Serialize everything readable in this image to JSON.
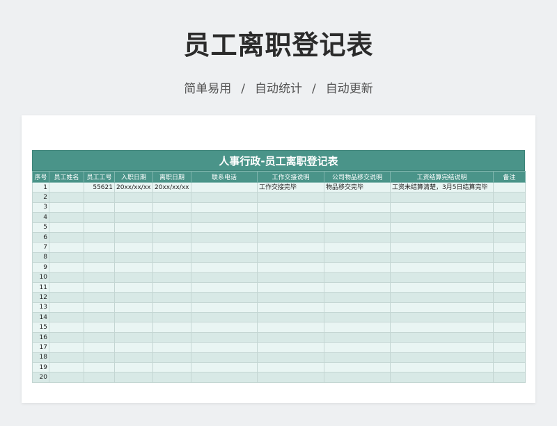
{
  "header": {
    "title": "员工离职登记表",
    "subtitle_parts": [
      "简单易用",
      "自动统计",
      "自动更新"
    ],
    "separator": "/"
  },
  "sheet": {
    "title": "人事行政-员工离职登记表",
    "columns": [
      "序号",
      "员工姓名",
      "员工工号",
      "入职日期",
      "离职日期",
      "联系电话",
      "工作交接说明",
      "公司物品移交说明",
      "工资结算完结说明",
      "备注"
    ],
    "rows": [
      [
        "1",
        "",
        "55621",
        "20xx/xx/xx",
        "20xx/xx/xx",
        "",
        "工作交接完毕",
        "物品移交完毕",
        "工资未结算清楚，3月5日结算完毕",
        ""
      ],
      [
        "2",
        "",
        "",
        "",
        "",
        "",
        "",
        "",
        "",
        ""
      ],
      [
        "3",
        "",
        "",
        "",
        "",
        "",
        "",
        "",
        "",
        ""
      ],
      [
        "4",
        "",
        "",
        "",
        "",
        "",
        "",
        "",
        "",
        ""
      ],
      [
        "5",
        "",
        "",
        "",
        "",
        "",
        "",
        "",
        "",
        ""
      ],
      [
        "6",
        "",
        "",
        "",
        "",
        "",
        "",
        "",
        "",
        ""
      ],
      [
        "7",
        "",
        "",
        "",
        "",
        "",
        "",
        "",
        "",
        ""
      ],
      [
        "8",
        "",
        "",
        "",
        "",
        "",
        "",
        "",
        "",
        ""
      ],
      [
        "9",
        "",
        "",
        "",
        "",
        "",
        "",
        "",
        "",
        ""
      ],
      [
        "10",
        "",
        "",
        "",
        "",
        "",
        "",
        "",
        "",
        ""
      ],
      [
        "11",
        "",
        "",
        "",
        "",
        "",
        "",
        "",
        "",
        ""
      ],
      [
        "12",
        "",
        "",
        "",
        "",
        "",
        "",
        "",
        "",
        ""
      ],
      [
        "13",
        "",
        "",
        "",
        "",
        "",
        "",
        "",
        "",
        ""
      ],
      [
        "14",
        "",
        "",
        "",
        "",
        "",
        "",
        "",
        "",
        ""
      ],
      [
        "15",
        "",
        "",
        "",
        "",
        "",
        "",
        "",
        "",
        ""
      ],
      [
        "16",
        "",
        "",
        "",
        "",
        "",
        "",
        "",
        "",
        ""
      ],
      [
        "17",
        "",
        "",
        "",
        "",
        "",
        "",
        "",
        "",
        ""
      ],
      [
        "18",
        "",
        "",
        "",
        "",
        "",
        "",
        "",
        "",
        ""
      ],
      [
        "19",
        "",
        "",
        "",
        "",
        "",
        "",
        "",
        "",
        ""
      ],
      [
        "20",
        "",
        "",
        "",
        "",
        "",
        "",
        "",
        "",
        ""
      ]
    ]
  },
  "colors": {
    "header_teal": "#4a9489",
    "row_light": "#e9f5f3",
    "row_dark": "#d8e9e6",
    "background": "#eef0f2"
  }
}
